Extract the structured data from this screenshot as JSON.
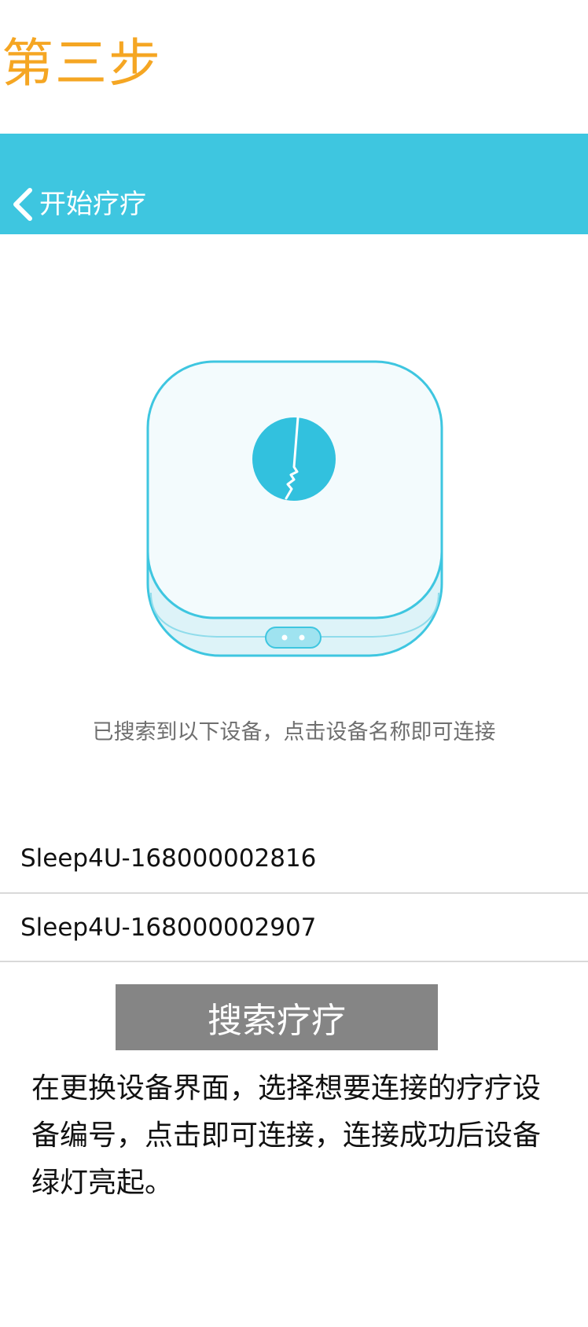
{
  "step_title": "第三步",
  "nav": {
    "back_label": "开始疗疗"
  },
  "device_illustration": {
    "icon": "sleep-device-icon"
  },
  "hint": "已搜索到以下设备，点击设备名称即可连接",
  "devices": [
    {
      "name": "Sleep4U-168000002816"
    },
    {
      "name": "Sleep4U-168000002907"
    }
  ],
  "search_button_label": "搜索疗疗",
  "instruction": "在更换设备界面，选择想要连接的疗疗设备编号，点击即可连接，连接成功后设备绿灯亮起。",
  "colors": {
    "accent_orange": "#F5A623",
    "nav_cyan": "#3EC6E0",
    "button_gray": "#858585"
  }
}
